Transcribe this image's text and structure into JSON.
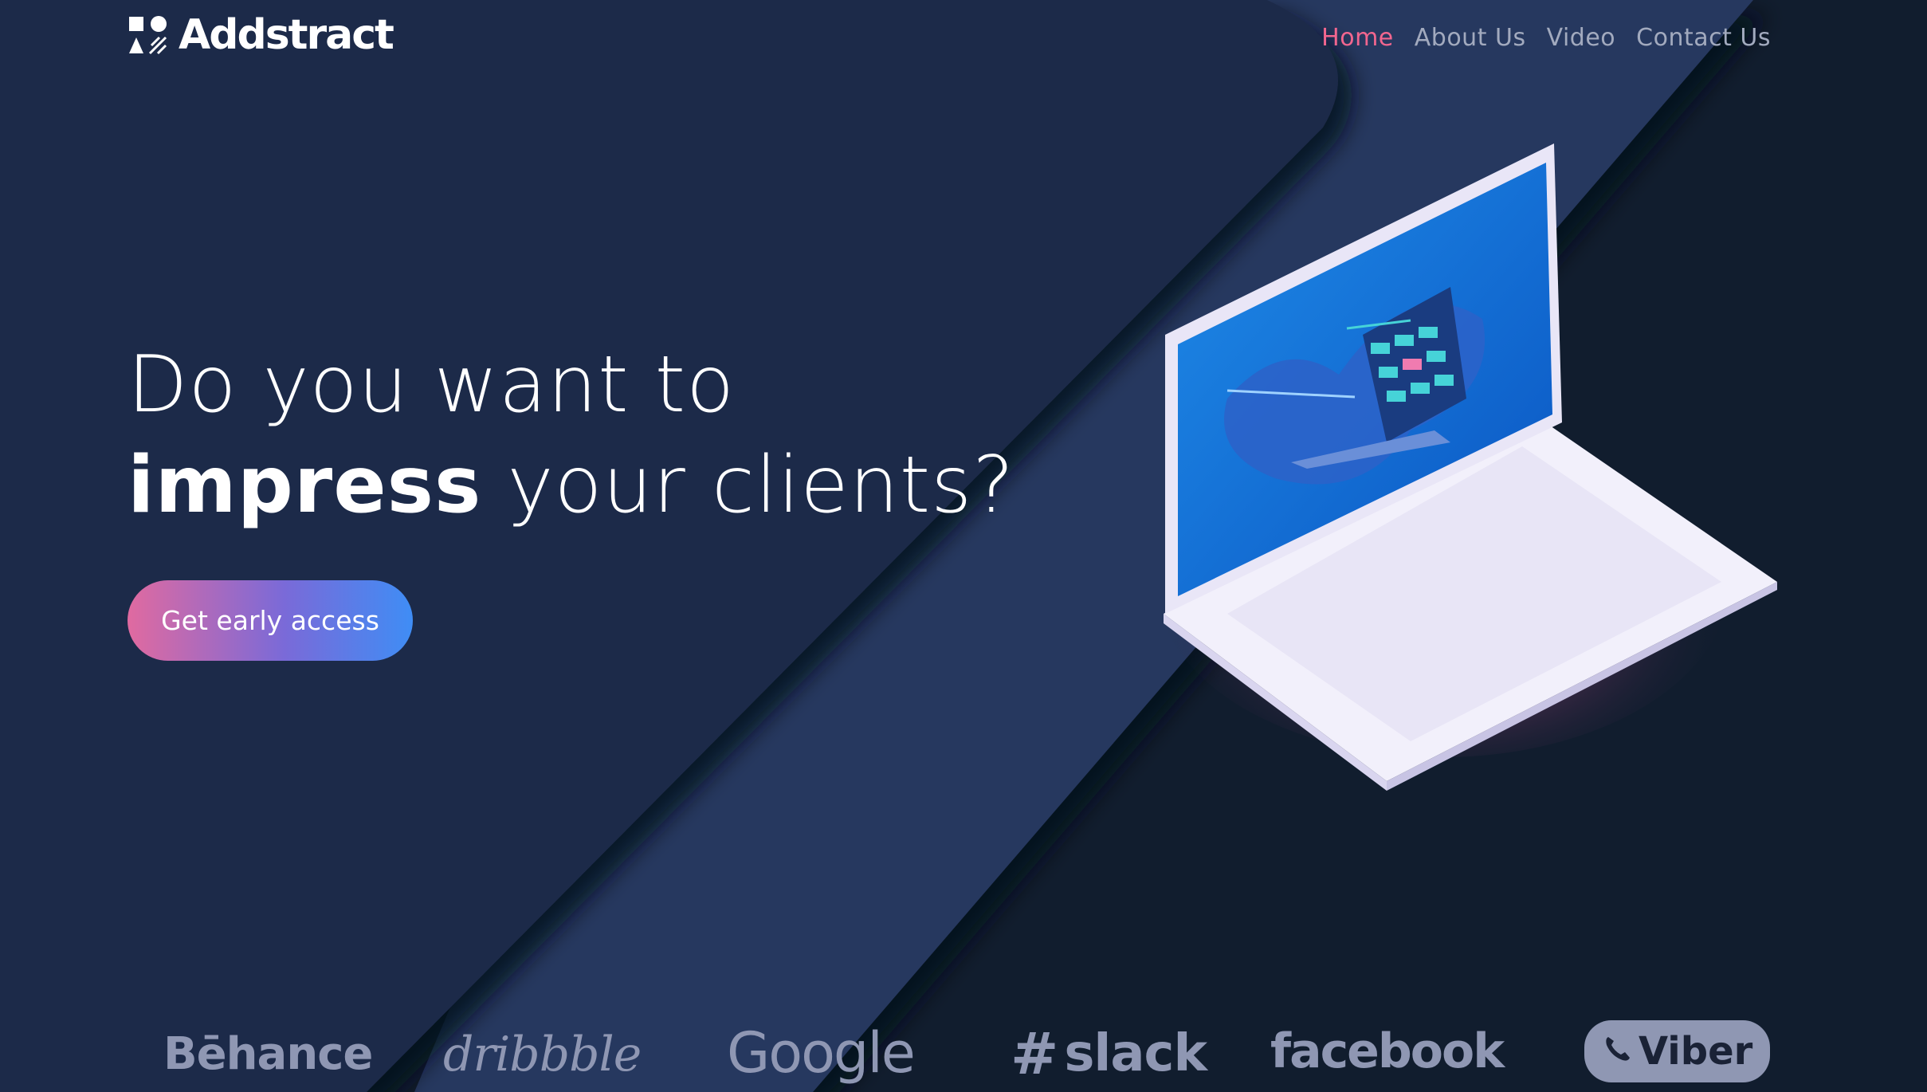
{
  "brand": {
    "name": "Addstract"
  },
  "nav": {
    "items": [
      {
        "label": "Home",
        "active": true
      },
      {
        "label": "About Us",
        "active": false
      },
      {
        "label": "Video",
        "active": false
      },
      {
        "label": "Contact Us",
        "active": false
      }
    ]
  },
  "hero": {
    "line1": "Do you want to",
    "line2_strong": "impress",
    "line2_rest": " your clients?",
    "cta_label": "Get early access"
  },
  "partners": {
    "behance": "Bēhance",
    "dribbble": "dribbble",
    "google": "Google",
    "slack": "slack",
    "facebook": "facebook",
    "viber": "Viber"
  },
  "colors": {
    "background_dark": "#111d2e",
    "panel": "#1f2a48",
    "stripe": "#27375e",
    "accent_pink": "#f2668f",
    "nav_text": "#a2aabe",
    "brand_gray": "#8f97b3"
  },
  "icons": {
    "logo": "addstract-logo-icon",
    "slack": "slack-hash-icon",
    "viber": "viber-phone-icon"
  }
}
